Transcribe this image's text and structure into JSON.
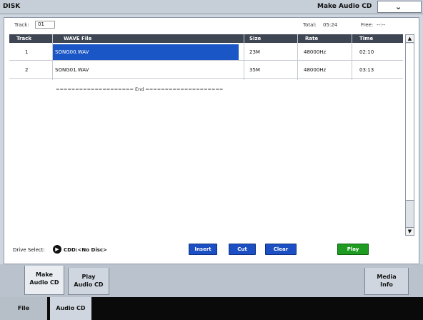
{
  "titlebar": {
    "app": "DISK",
    "page": "Make Audio CD",
    "dropdown_icon": "chevron-down-icon"
  },
  "track_select": {
    "label": "Track:",
    "value": "01"
  },
  "summary": {
    "total_label": "Total:",
    "total": "05:24",
    "free_label": "Free:",
    "free": "--:--"
  },
  "table": {
    "columns": [
      "Track",
      "WAVE File",
      "Size",
      "Rate",
      "Time"
    ],
    "rows": [
      {
        "track": "1",
        "file": "SONG00.WAV",
        "size": "23M",
        "rate": "48000Hz",
        "time": "02:10"
      },
      {
        "track": "2",
        "file": "SONG01.WAV",
        "size": "35M",
        "rate": "48000Hz",
        "time": "03:13"
      }
    ],
    "end_marker": "==================== End ===================="
  },
  "drive": {
    "label": "Drive Select:",
    "value": "CDD:<No Disc>"
  },
  "buttons": {
    "insert": "Insert",
    "cut": "Cut",
    "clear": "Clear",
    "play": "Play"
  },
  "tabs": {
    "make_line1": "Make",
    "make_line2": "Audio CD",
    "play_line1": "Play",
    "play_line2": "Audio CD",
    "media_line1": "Media",
    "media_line2": "Info"
  },
  "bottom_tabs": {
    "file": "File",
    "audio_cd": "Audio CD"
  },
  "colors": {
    "selection": "#1a56c6",
    "button_blue": "#1c4fc4",
    "button_green": "#1f9b22",
    "header_dark": "#3e4654"
  }
}
